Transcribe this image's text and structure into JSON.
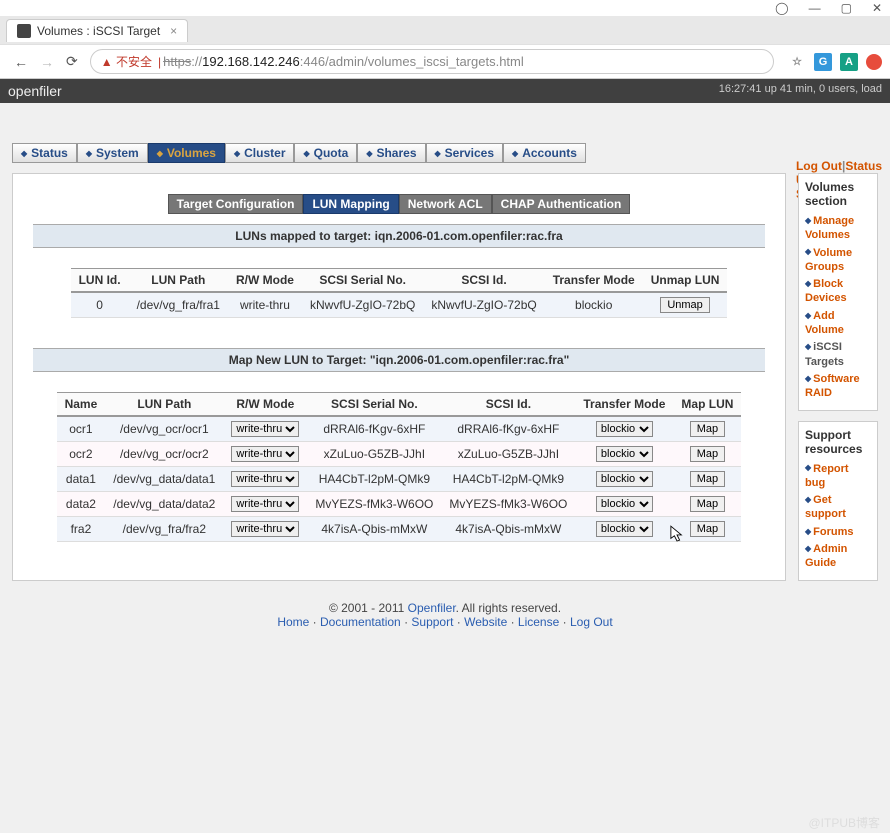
{
  "window": {
    "user_icon": "◯",
    "min": "—",
    "max": "▢",
    "close": "✕"
  },
  "tab": {
    "title": "Volumes : iSCSI Target"
  },
  "addr": {
    "warn_icon": "▲",
    "warn_text": "不安全",
    "scheme": "https",
    "host": "192.168.142.246",
    "port": ":446",
    "path": "/admin/volumes_iscsi_targets.html"
  },
  "header": {
    "logo": "openfiler",
    "uptime": "16:27:41 up 41 min, 0 users, load",
    "links": {
      "logout": "Log Out",
      "status": "Status",
      "update": "Update",
      "shutdown": "Shutdown"
    }
  },
  "nav": {
    "items": [
      "Status",
      "System",
      "Volumes",
      "Cluster",
      "Quota",
      "Shares",
      "Services",
      "Accounts"
    ],
    "active": "Volumes"
  },
  "subtabs": {
    "items": [
      "Target Configuration",
      "LUN Mapping",
      "Network ACL",
      "CHAP Authentication"
    ],
    "active": "LUN Mapping"
  },
  "mapped": {
    "title": "LUNs mapped to target: iqn.2006-01.com.openfiler:rac.fra",
    "headers": [
      "LUN Id.",
      "LUN Path",
      "R/W Mode",
      "SCSI Serial No.",
      "SCSI Id.",
      "Transfer Mode",
      "Unmap LUN"
    ],
    "rows": [
      {
        "id": "0",
        "path": "/dev/vg_fra/fra1",
        "rw": "write-thru",
        "serial": "kNwvfU-ZgIO-72bQ",
        "scsi": "kNwvfU-ZgIO-72bQ",
        "transfer": "blockio",
        "btn": "Unmap"
      }
    ]
  },
  "mapnew": {
    "title": "Map New LUN to Target: \"iqn.2006-01.com.openfiler:rac.fra\"",
    "headers": [
      "Name",
      "LUN Path",
      "R/W Mode",
      "SCSI Serial No.",
      "SCSI Id.",
      "Transfer Mode",
      "Map LUN"
    ],
    "rows": [
      {
        "name": "ocr1",
        "path": "/dev/vg_ocr/ocr1",
        "rw": "write-thru",
        "serial": "dRRAl6-fKgv-6xHF",
        "scsi": "dRRAl6-fKgv-6xHF",
        "transfer": "blockio",
        "btn": "Map"
      },
      {
        "name": "ocr2",
        "path": "/dev/vg_ocr/ocr2",
        "rw": "write-thru",
        "serial": "xZuLuo-G5ZB-JJhI",
        "scsi": "xZuLuo-G5ZB-JJhI",
        "transfer": "blockio",
        "btn": "Map"
      },
      {
        "name": "data1",
        "path": "/dev/vg_data/data1",
        "rw": "write-thru",
        "serial": "HA4CbT-l2pM-QMk9",
        "scsi": "HA4CbT-l2pM-QMk9",
        "transfer": "blockio",
        "btn": "Map"
      },
      {
        "name": "data2",
        "path": "/dev/vg_data/data2",
        "rw": "write-thru",
        "serial": "MvYEZS-fMk3-W6OO",
        "scsi": "MvYEZS-fMk3-W6OO",
        "transfer": "blockio",
        "btn": "Map"
      },
      {
        "name": "fra2",
        "path": "/dev/vg_fra/fra2",
        "rw": "write-thru",
        "serial": "4k7isA-Qbis-mMxW",
        "scsi": "4k7isA-Qbis-mMxW",
        "transfer": "blockio",
        "btn": "Map"
      }
    ]
  },
  "sidebar": {
    "volumes": {
      "title": "Volumes section",
      "links": [
        "Manage Volumes",
        "Volume Groups",
        "Block Devices",
        "Add Volume",
        "iSCSI Targets",
        "Software RAID"
      ],
      "current": "iSCSI Targets"
    },
    "support": {
      "title": "Support resources",
      "links": [
        "Report bug",
        "Get support",
        "Forums",
        "Admin Guide"
      ]
    }
  },
  "footer": {
    "copyright": "© 2001 - 2011 ",
    "brand": "Openfiler",
    "rights": ". All rights reserved.",
    "links": [
      "Home",
      "Documentation",
      "Support",
      "Website",
      "License",
      "Log Out"
    ]
  },
  "watermark": "@ITPUB博客"
}
